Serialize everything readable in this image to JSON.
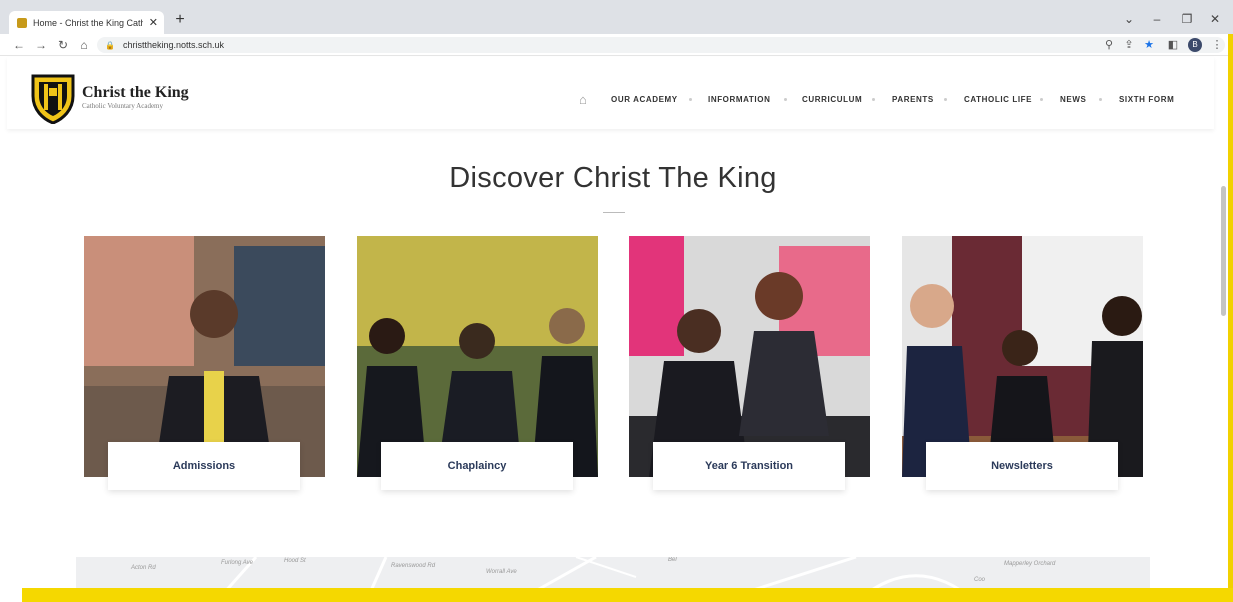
{
  "browser": {
    "tab_title": "Home - Christ the King Catholic",
    "url": "christtheking.notts.sch.uk",
    "profile_initial": "B"
  },
  "site": {
    "name": "Christ the King",
    "subtitle": "Catholic Voluntary Academy",
    "nav": [
      "OUR ACADEMY",
      "INFORMATION",
      "CURRICULUM",
      "PARENTS",
      "CATHOLIC LIFE",
      "NEWS",
      "SIXTH FORM"
    ]
  },
  "main": {
    "heading": "Discover Christ The King",
    "cards": [
      {
        "label": "Admissions"
      },
      {
        "label": "Chaplaincy"
      },
      {
        "label": "Year 6 Transition"
      },
      {
        "label": "Newsletters"
      }
    ]
  },
  "map": {
    "streets": [
      "Acton Rd",
      "Furlong Ave",
      "Hood St",
      "Ravenswood Rd",
      "Worrall Ave",
      "Bel",
      "Mapperley Orchard",
      "Coo"
    ]
  },
  "colors": {
    "accent": "#f5d800",
    "navy": "#2b3a5a",
    "crest_gold": "#e0b21c"
  }
}
